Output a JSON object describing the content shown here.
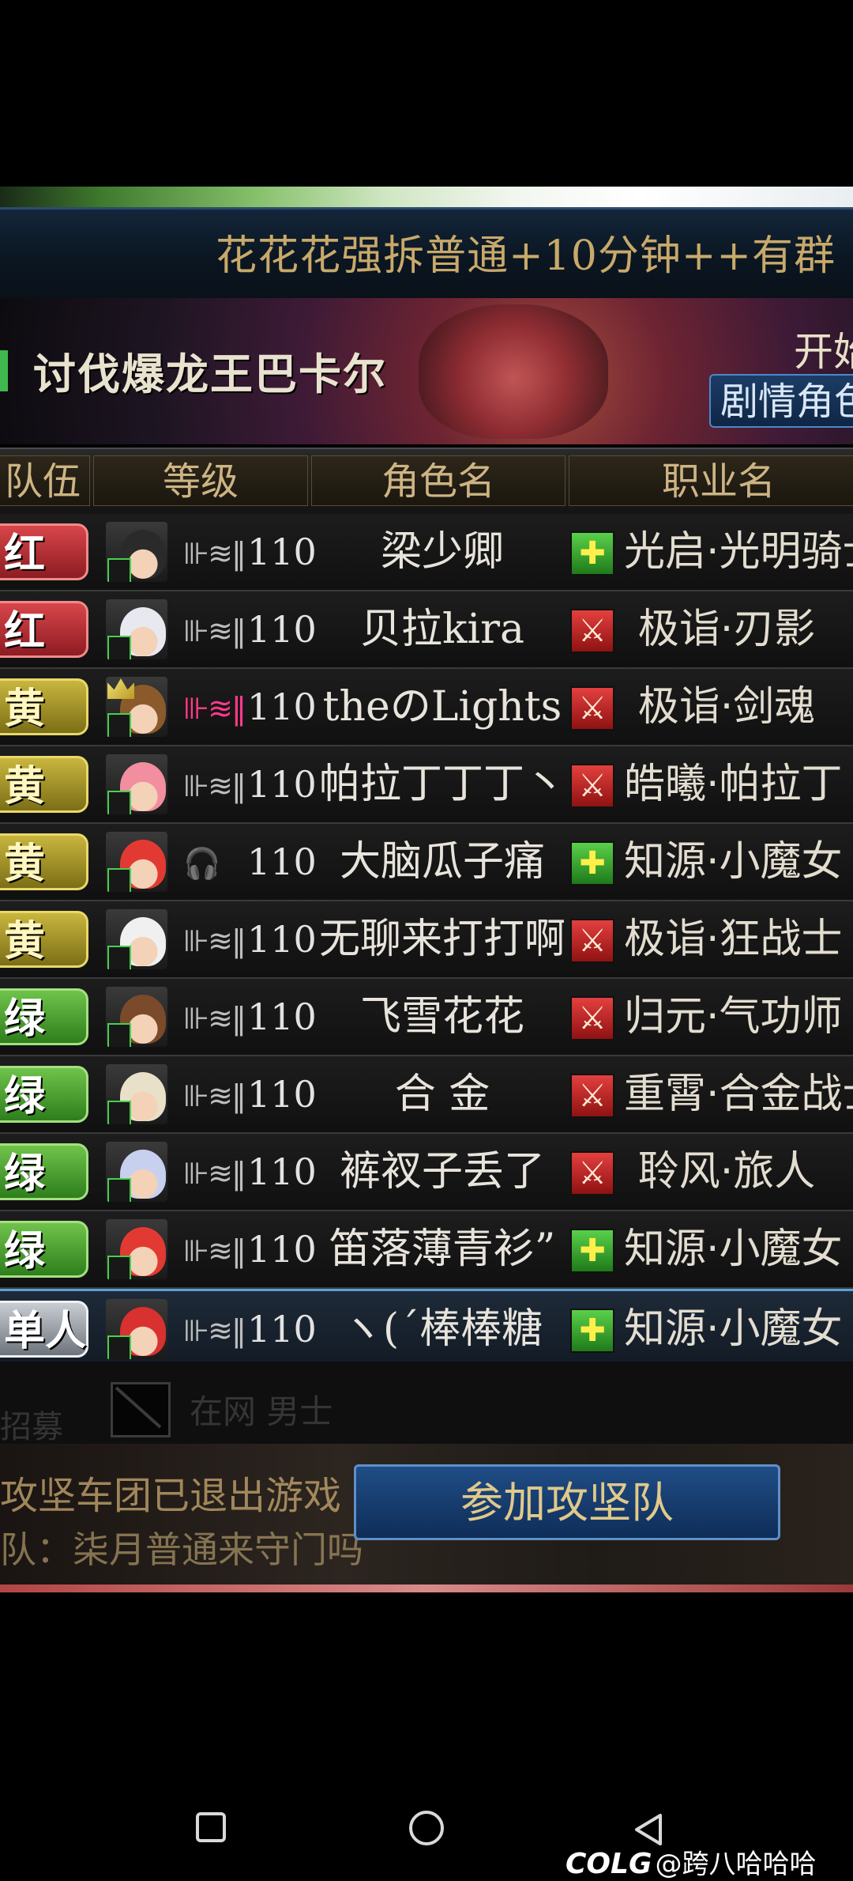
{
  "room": {
    "title": "花花花强拆普通+10分钟++有群"
  },
  "dungeon": {
    "name": "讨伐爆龙王巴卡尔",
    "open_label": "开始",
    "story_button": "剧情角色"
  },
  "columns": [
    "队伍",
    "等级",
    "角色名",
    "职业名"
  ],
  "players": [
    {
      "team": "红",
      "team_color": "red",
      "status_icon": "signal-icon",
      "level": "110",
      "name": "梁少卿",
      "role": "heal",
      "job": "光启·光明骑士",
      "avatar_hair": "#2a2a2a",
      "leader": false
    },
    {
      "team": "红",
      "team_color": "red",
      "status_icon": "signal-icon",
      "level": "110",
      "name": "贝拉kira",
      "role": "dps",
      "job": "极诣·刃影",
      "avatar_hair": "#e8e8f0",
      "leader": false
    },
    {
      "team": "黄",
      "team_color": "yellow",
      "status_icon": "signal-icon-active",
      "level": "110",
      "name": "theのLights",
      "role": "dps",
      "job": "极诣·剑魂",
      "avatar_hair": "#8b5a2b",
      "leader": true
    },
    {
      "team": "黄",
      "team_color": "yellow",
      "status_icon": "signal-icon",
      "level": "110",
      "name": "帕拉丁丁丁丶",
      "role": "dps",
      "job": "皓曦·帕拉丁",
      "avatar_hair": "#f28ea0",
      "leader": false
    },
    {
      "team": "黄",
      "team_color": "yellow",
      "status_icon": "headset-icon",
      "level": "110",
      "name": "大脑瓜子痛",
      "role": "heal",
      "job": "知源·小魔女",
      "avatar_hair": "#e23a32",
      "leader": false
    },
    {
      "team": "黄",
      "team_color": "yellow",
      "status_icon": "signal-icon",
      "level": "110",
      "name": "无聊来打打啊",
      "role": "dps",
      "job": "极诣·狂战士",
      "avatar_hair": "#f0f0f0",
      "leader": false
    },
    {
      "team": "绿",
      "team_color": "green",
      "status_icon": "signal-icon",
      "level": "110",
      "name": "飞雪花花",
      "role": "dps",
      "job": "归元·气功师",
      "avatar_hair": "#7a4a2a",
      "leader": false
    },
    {
      "team": "绿",
      "team_color": "green",
      "status_icon": "signal-icon",
      "level": "110",
      "name": "合 金",
      "role": "dps",
      "job": "重霄·合金战士",
      "avatar_hair": "#e8e0c8",
      "leader": false
    },
    {
      "team": "绿",
      "team_color": "green",
      "status_icon": "signal-icon",
      "level": "110",
      "name": "裤衩子丢了",
      "role": "dps",
      "job": "聆风·旅人",
      "avatar_hair": "#c8d0f0",
      "leader": false
    },
    {
      "team": "绿",
      "team_color": "green",
      "status_icon": "signal-icon",
      "level": "110",
      "name": "笛落薄青衫”",
      "role": "heal",
      "job": "知源·小魔女",
      "avatar_hair": "#e23a32",
      "leader": false
    },
    {
      "team": "单人",
      "team_color": "single",
      "status_icon": "signal-icon",
      "level": "110",
      "name": "ヽ(ˊ棒棒糖",
      "role": "heal",
      "job": "知源·小魔女",
      "avatar_hair": "#d93030",
      "leader": false
    }
  ],
  "empty_row": {
    "faint_text": "在网 男士",
    "faint_left": "招募"
  },
  "notices": {
    "line1": "攻坚车团已退出游戏",
    "line2": "队：柒月普通来守门吗"
  },
  "join_button": "参加攻坚队",
  "watermark": {
    "logo": "COLG",
    "user": "@跨八哈哈哈"
  },
  "navbar": {
    "items": [
      "recent-apps-icon",
      "home-icon",
      "back-icon"
    ]
  }
}
